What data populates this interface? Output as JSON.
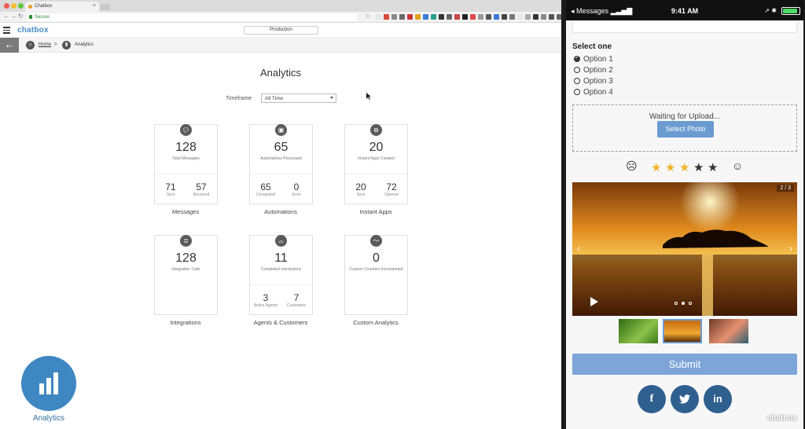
{
  "browser": {
    "tab_title": "Chatbox",
    "url_text": "Secure"
  },
  "app": {
    "logo": "chatbox",
    "environment": "Production"
  },
  "breadcrumb": {
    "home": "Home",
    "separator": ">",
    "current": "Analytics"
  },
  "page": {
    "title": "Analytics",
    "timeframe_label": "Timeframe",
    "timeframe_value": "All Time"
  },
  "cards": [
    {
      "name": "Messages",
      "icon": "chat-bubble-icon",
      "value": "128",
      "caption": "Total Messages",
      "stats": [
        {
          "value": "71",
          "label": "Sent"
        },
        {
          "value": "57",
          "label": "Received"
        }
      ]
    },
    {
      "name": "Automations",
      "icon": "lock-icon",
      "value": "65",
      "caption": "Automations Processed",
      "stats": [
        {
          "value": "65",
          "label": "Completed"
        },
        {
          "value": "0",
          "label": "Error"
        }
      ]
    },
    {
      "name": "Instant Apps",
      "icon": "instant-app-icon",
      "value": "20",
      "caption": "Instant Apps Created",
      "stats": [
        {
          "value": "20",
          "label": "Sent"
        },
        {
          "value": "72",
          "label": "Opened"
        }
      ]
    },
    {
      "name": "Integrations",
      "icon": "database-icon",
      "value": "128",
      "caption": "Integration Calls",
      "stats": []
    },
    {
      "name": "Agents & Customers",
      "icon": "headset-icon",
      "value": "11",
      "caption": "Completed Interactions",
      "stats": [
        {
          "value": "3",
          "label": "Active Agents"
        },
        {
          "value": "7",
          "label": "Customers"
        }
      ]
    },
    {
      "name": "Custom Analytics",
      "icon": "trend-line-icon",
      "value": "0",
      "caption": "Custom Counters Incremented",
      "stats": []
    }
  ],
  "badge": {
    "label": "Analytics",
    "icon": "bar-chart-icon",
    "color": "#3f87c2"
  },
  "phone": {
    "status": {
      "carrier": "Messages",
      "time": "9:41 AM",
      "battery_level": 0.9
    },
    "select": {
      "heading": "Select one",
      "options": [
        "Option 1",
        "Option 2",
        "Option 3",
        "Option 4"
      ],
      "selected_index": 0
    },
    "upload": {
      "text": "Waiting for Upload...",
      "button": "Select Photo"
    },
    "rating": {
      "stars": 5,
      "value": 3
    },
    "gallery": {
      "counter": "2 / 3",
      "active_index": 1
    },
    "submit": "Submit",
    "social": [
      "f",
      "twitter-bird-icon",
      "in"
    ],
    "logo": "chatbox",
    "accent": "#7da5d8"
  }
}
